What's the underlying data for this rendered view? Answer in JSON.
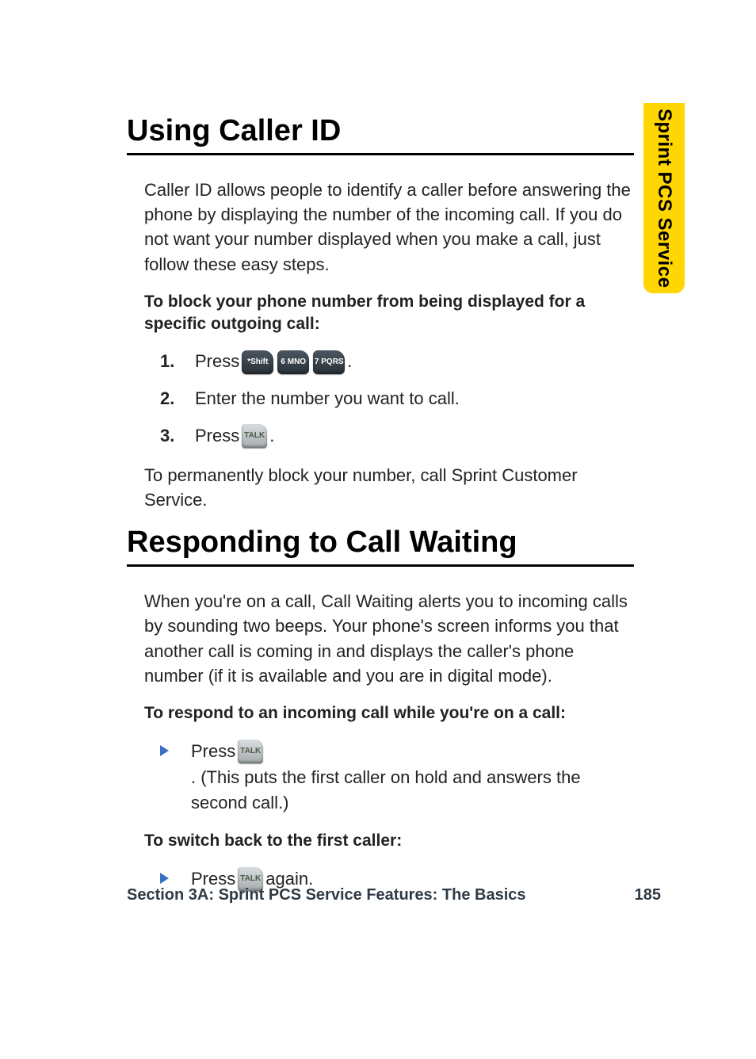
{
  "side_tab": "Sprint PCS Service",
  "section1": {
    "heading": "Using Caller ID",
    "intro": "Caller ID allows people to identify a caller before answering the phone by displaying the number of the incoming call. If you do not want your number displayed when you make a call, just follow these easy steps.",
    "lead": "To block your phone number from being displayed for a specific outgoing call:",
    "steps": {
      "n1": "1.",
      "s1_a": "Press ",
      "s1_keys": {
        "k1": "*Shift",
        "k2": "6 MNO",
        "k3": "7 PQRS"
      },
      "s1_b": ".",
      "n2": "2.",
      "s2": "Enter the number you want to call.",
      "n3": "3.",
      "s3_a": "Press ",
      "s3_key": "TALK",
      "s3_b": "."
    },
    "after": "To permanently block your number, call Sprint Customer Service."
  },
  "section2": {
    "heading": "Responding to Call Waiting",
    "intro": "When you're on a call, Call Waiting alerts you to incoming calls by sounding two beeps. Your phone's screen informs you that another call is coming in and displays the caller's phone number (if it is available and you are in digital mode).",
    "lead1": "To respond to an incoming call while you're on a call:",
    "bullet1_a": "Press ",
    "bullet1_key": "TALK",
    "bullet1_b": ". (This puts the first caller on hold and answers the second call.)",
    "lead2": "To switch back to the first caller:",
    "bullet2_a": "Press ",
    "bullet2_key": "TALK",
    "bullet2_b": " again."
  },
  "footer": {
    "section": "Section 3A: Sprint PCS Service Features: The Basics",
    "page": "185"
  }
}
